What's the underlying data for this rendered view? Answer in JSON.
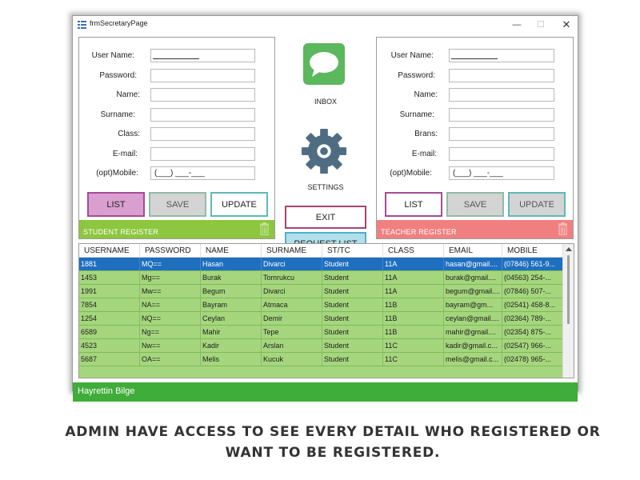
{
  "window": {
    "title": "frmSecretaryPage",
    "minimize_glyph": "—",
    "maximize_glyph": "☐",
    "close_glyph": "✕"
  },
  "student_form": {
    "labels": {
      "username": "User Name:",
      "password": "Password:",
      "name": "Name:",
      "surname": "Surname:",
      "class": "Class:",
      "email": "E-mail:",
      "mobile": "(opt)Mobile:"
    },
    "values": {
      "username": "",
      "password": "",
      "name": "",
      "surname": "",
      "class": "",
      "email": "",
      "mobile": "(___) ___-___"
    },
    "buttons": {
      "list": "LIST",
      "save": "SAVE",
      "update": "UPDATE"
    },
    "footer": "STUDENT REGISTER",
    "footer_color": "#8dc63f"
  },
  "teacher_form": {
    "labels": {
      "username": "User Name:",
      "password": "Password:",
      "name": "Name:",
      "surname": "Surname:",
      "brans": "Brans:",
      "email": "E-mail:",
      "mobile": "(opt)Mobile:"
    },
    "values": {
      "username": "",
      "password": "",
      "name": "",
      "surname": "",
      "brans": "",
      "email": "",
      "mobile": "(___) ___-___"
    },
    "buttons": {
      "list": "LIST",
      "save": "SAVE",
      "update": "UPDATE"
    },
    "footer": "TEACHER REGISTER",
    "footer_color": "#f08080"
  },
  "center": {
    "inbox_label": "INBOX",
    "settings_label": "SETTINGS",
    "exit_label": "EXIT",
    "request_list_label": "REQUEST LIST",
    "inbox_icon": "chat-bubble-icon",
    "settings_icon": "gear-icon"
  },
  "grid": {
    "columns": [
      "USERNAME",
      "PASSWORD",
      "NAME",
      "SURNAME",
      "ST/TC",
      "CLASS",
      "EMAIL",
      "MOBILE"
    ],
    "rows": [
      [
        "1881",
        "MQ==",
        "Hasan",
        "Divarci",
        "Student",
        "11A",
        "hasan@gmail....",
        "(07846) 561-9..."
      ],
      [
        "1453",
        "Mg==",
        "Burak",
        "Tomrukcu",
        "Student",
        "11A",
        "burak@gmail....",
        "(04563) 254-..."
      ],
      [
        "1991",
        "Mw==",
        "Begum",
        "Divarci",
        "Student",
        "11A",
        "begum@gmail....",
        "(07846) 507-..."
      ],
      [
        "7854",
        "NA==",
        "Bayram",
        "Atmaca",
        "Student",
        "11B",
        "bayram@gm...",
        "(02541) 458-8..."
      ],
      [
        "1254",
        "NQ==",
        "Ceylan",
        "Demir",
        "Student",
        "11B",
        "ceylan@gmail....",
        "(02364) 789-..."
      ],
      [
        "6589",
        "Ng==",
        "Mahir",
        "Tepe",
        "Student",
        "11B",
        "mahir@gmail....",
        "(02354) 875-..."
      ],
      [
        "4523",
        "Nw==",
        "Kadir",
        "Arslan",
        "Student",
        "11C",
        "kadir@gmail.c...",
        "(02547) 966-..."
      ],
      [
        "5687",
        "OA==",
        "Melis",
        "Kucuk",
        "Student",
        "11C",
        "melis@gmail.c...",
        "(02478) 965-..."
      ]
    ],
    "selected_row": 0
  },
  "status_bar": {
    "text": "Hayrettin Bilge"
  },
  "caption": {
    "line1": "ADMIN HAVE ACCESS TO SEE EVERY DETAIL WHO REGISTERED OR",
    "line2": "WANT TO BE REGISTERED."
  },
  "colors": {
    "list_fill": "#d9a0cf",
    "list_border": "#a64b98",
    "save_fill": "#d4d4d4",
    "save_border": "#8fbca6",
    "update_border": "#5fb9b6",
    "exit_border": "#a8456d",
    "request_fill": "#b2e0ea",
    "request_border": "#4fb1c6",
    "grid_selected": "#1f6fbf",
    "grid_rows": "#a5d67d",
    "status_bar": "#3fad3a"
  }
}
